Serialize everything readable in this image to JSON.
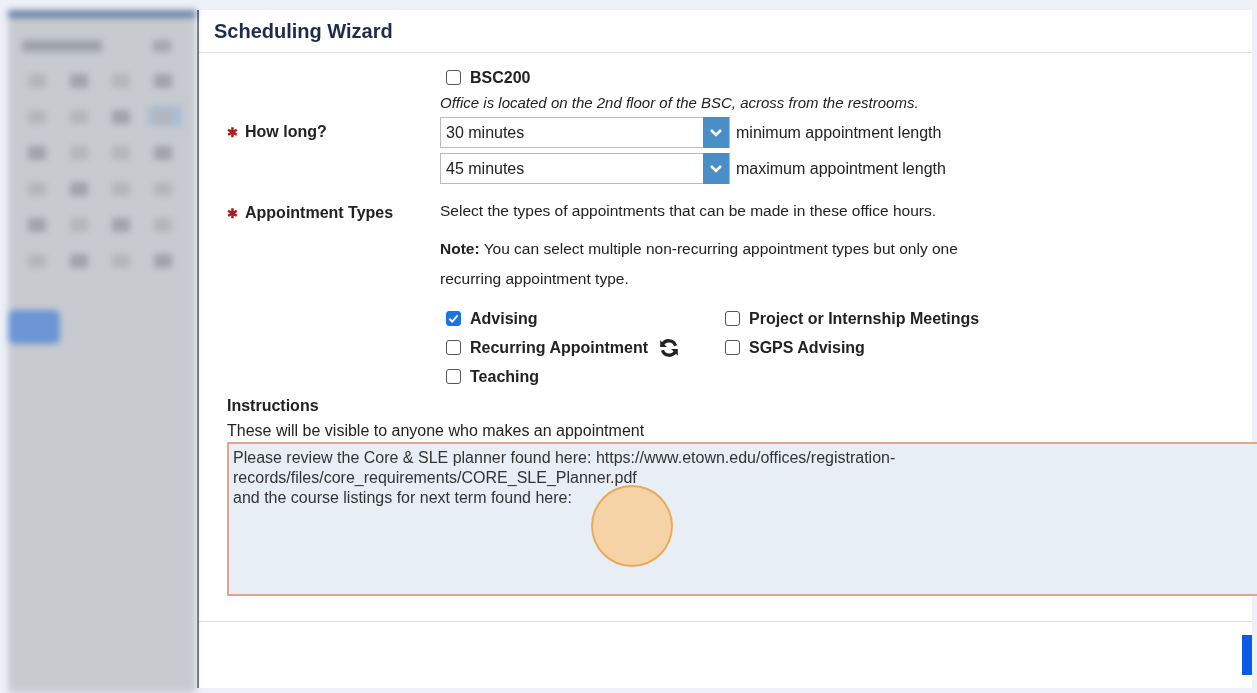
{
  "dialog": {
    "title": "Scheduling Wizard"
  },
  "location": {
    "option": {
      "label": "BSC200",
      "checked": false
    },
    "note": "Office is located on the 2nd floor of the BSC, across from the restrooms."
  },
  "how_long": {
    "marker": "✱",
    "label": "How long?",
    "selects": [
      {
        "value": "30 minutes",
        "hint": "minimum appointment length"
      },
      {
        "value": "45 minutes",
        "hint": "maximum appointment length"
      }
    ]
  },
  "appointment_types": {
    "marker": "✱",
    "label": "Appointment Types",
    "description": "Select the types of appointments that can be made in these office hours.",
    "note": "**Note:** You can select multiple non-recurring appointment types but only one recurring appointment type.",
    "options": [
      {
        "label": "Advising",
        "checked": true,
        "kind": "plain"
      },
      {
        "label": "Recurring Appointment",
        "checked": false,
        "kind": "recurring"
      },
      {
        "label": "Teaching",
        "checked": false,
        "kind": "plain"
      },
      {
        "label": "Project or Internship Meetings",
        "checked": false,
        "kind": "plain"
      },
      {
        "label": "SGPS Advising",
        "checked": false,
        "kind": "plain"
      }
    ]
  },
  "instructions": {
    "label": "Instructions",
    "hint": "These will be visible to anyone who makes an appointment",
    "value": "Please review the Core & SLE planner found here: https://www.etown.edu/offices/registration-\nrecords/files/core_requirements/CORE_SLE_Planner.pdf\nand the course listings for next term found here:",
    "focused": true
  },
  "click_marker": {
    "visible": true
  }
}
